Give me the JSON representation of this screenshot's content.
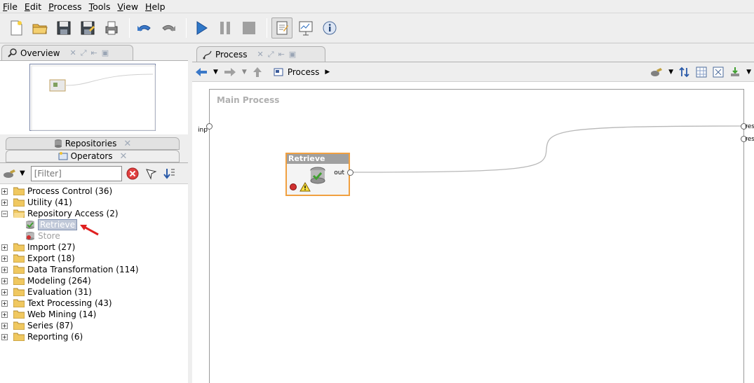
{
  "menu": [
    "File",
    "Edit",
    "Process",
    "Tools",
    "View",
    "Help"
  ],
  "toolbar": {
    "buttons": [
      "new-process-icon",
      "open-folder-icon",
      "save-icon",
      "save-as-icon",
      "print-icon",
      "undo-icon",
      "redo-icon",
      "run-icon",
      "pause-icon",
      "stop-icon",
      "design-perspective-icon",
      "results-perspective-icon",
      "info-icon"
    ]
  },
  "overview": {
    "tab_label": "Overview"
  },
  "repositories": {
    "tab_label": "Repositories"
  },
  "operators": {
    "tab_label": "Operators",
    "filter_placeholder": "[Filter]",
    "tree": [
      {
        "label": "Process Control (36)",
        "expanded": false
      },
      {
        "label": "Utility (41)",
        "expanded": false
      },
      {
        "label": "Repository Access (2)",
        "expanded": true
      },
      {
        "label": "Retrieve",
        "leaf": true,
        "selected": true
      },
      {
        "label": "Store",
        "leaf": true,
        "disabled": true
      },
      {
        "label": "Import (27)",
        "expanded": false
      },
      {
        "label": "Export (18)",
        "expanded": false
      },
      {
        "label": "Data Transformation (114)",
        "expanded": false
      },
      {
        "label": "Modeling (264)",
        "expanded": false
      },
      {
        "label": "Evaluation (31)",
        "expanded": false
      },
      {
        "label": "Text Processing (43)",
        "expanded": false
      },
      {
        "label": "Web Mining (14)",
        "expanded": false
      },
      {
        "label": "Series (87)",
        "expanded": false
      },
      {
        "label": "Reporting (6)",
        "expanded": false
      }
    ]
  },
  "process": {
    "tab_label": "Process",
    "breadcrumb": "Process",
    "canvas_title": "Main Process",
    "inp_label": "inp",
    "res_labels": [
      "res",
      "res"
    ],
    "operator": {
      "name": "Retrieve",
      "port_out": "out"
    }
  },
  "colors": {
    "operator_border": "#f0a040",
    "selection": "#c0c8d8",
    "arrow": "#e02020"
  }
}
